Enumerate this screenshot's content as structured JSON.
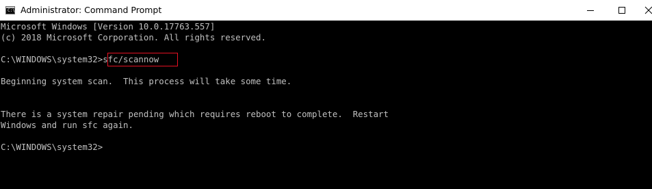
{
  "window": {
    "title": "Administrator: Command Prompt",
    "icon": "cmd-icon",
    "controls": {
      "minimize": "minimize-icon",
      "maximize": "maximize-icon",
      "close": "close-icon"
    }
  },
  "console": {
    "line1": "Microsoft Windows [Version 10.0.17763.557]",
    "line2": "(c) 2018 Microsoft Corporation. All rights reserved.",
    "prompt1": "C:\\WINDOWS\\system32>",
    "command": "sfc/scannow",
    "line4": "Beginning system scan.  This process will take some time.",
    "line6": "There is a system repair pending which requires reboot to complete.  Restart",
    "line7": "Windows and run sfc again.",
    "prompt2": "C:\\WINDOWS\\system32>"
  },
  "colors": {
    "console_bg": "#000000",
    "console_text": "#c0c0c0",
    "highlight_border": "#e81123",
    "titlebar_bg": "#ffffff"
  }
}
